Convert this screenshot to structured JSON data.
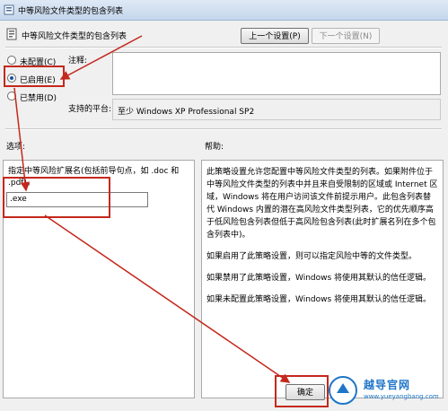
{
  "window": {
    "title": "中等风险文件类型的包含列表"
  },
  "header": {
    "setting_label": "中等风险文件类型的包含列表",
    "prev_button": "上一个设置(P)",
    "next_button": "下一个设置(N)"
  },
  "state": {
    "options": [
      {
        "label": "未配置(C)",
        "checked": false
      },
      {
        "label": "已启用(E)",
        "checked": true
      },
      {
        "label": "已禁用(D)",
        "checked": false
      }
    ],
    "comment_label": "注释:",
    "comment_value": "",
    "platform_label": "支持的平台:",
    "platform_value": "至少 Windows XP Professional SP2"
  },
  "options_section": {
    "label": "选项:",
    "description": "指定中等风险扩展名(包括前导句点，如 .doc 和 .pdf)。",
    "input_value": ".exe"
  },
  "help_section": {
    "label": "帮助:",
    "paragraphs": [
      "此策略设置允许您配置中等风险文件类型的列表。如果附件位于中等风险文件类型的列表中并且来自受限制的区域或 Internet 区域，Windows 将在用户访问该文件前提示用户。此包含列表替代 Windows 内置的潜在高风险文件类型列表，它的优先顺序高于低风险包含列表但低于高风险包含列表(此时扩展名列在多个包含列表中)。",
      "如果启用了此策略设置，则可以指定风险中等的文件类型。",
      "如果禁用了此策略设置，Windows 将使用其默认的信任逻辑。",
      "如果未配置此策略设置，Windows 将使用其默认的信任逻辑。"
    ]
  },
  "footer": {
    "ok_button": "确定"
  },
  "watermark": {
    "brand": "越导官网",
    "url": "www.yueyangbang.com"
  },
  "colors": {
    "annotation": "#c4281d",
    "accent": "#1f76c8"
  }
}
